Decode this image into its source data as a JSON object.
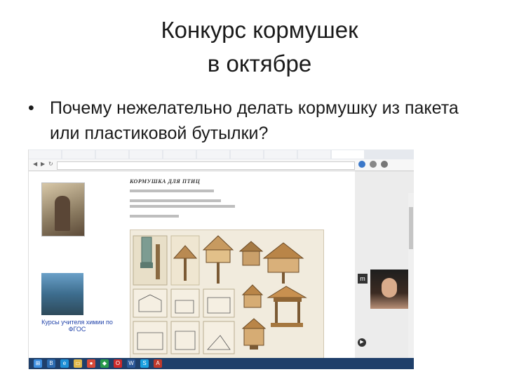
{
  "slide": {
    "title_line1": "Конкурс кормушек",
    "title_line2": "в октябре",
    "bullet_symbol": "•",
    "bullet_text": "Почему нежелательно делать кормушку из пакета или пластиковой бутылки?"
  },
  "screenshot": {
    "document_heading": "КОРМУШКА ДЛЯ ПТИЦ",
    "ad_title": "Курсы учителя химии по ФГОС",
    "taskbar_icons": [
      "windows-icon",
      "browser-icon",
      "ie-icon",
      "folder-icon",
      "chrome-icon",
      "shield-icon",
      "opera-icon",
      "word-icon",
      "skype-icon",
      "pdf-icon"
    ]
  }
}
